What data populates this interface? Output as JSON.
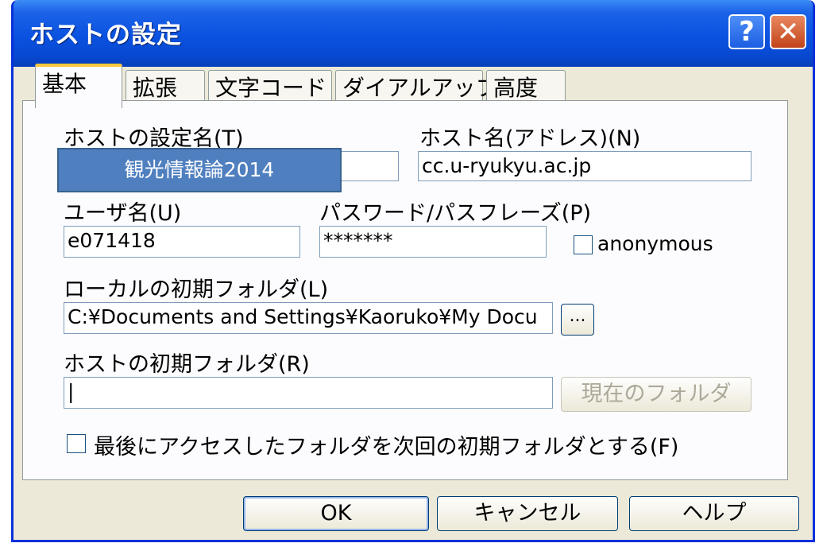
{
  "window": {
    "title": "ホストの設定",
    "help_glyph": "?",
    "close_glyph": "✕"
  },
  "tabs": [
    {
      "label": "基本",
      "active": true
    },
    {
      "label": "拡張",
      "active": false
    },
    {
      "label": "文字コード",
      "active": false
    },
    {
      "label": "ダイアルアップ",
      "active": false
    },
    {
      "label": "高度",
      "active": false
    }
  ],
  "fields": {
    "setting_name": {
      "label": "ホストの設定名(T)",
      "value": ""
    },
    "host_name": {
      "label": "ホスト名(アドレス)(N)",
      "value": "cc.u-ryukyu.ac.jp"
    },
    "username": {
      "label": "ユーザ名(U)",
      "value": "e071418"
    },
    "password": {
      "label": "パスワード/パスフレーズ(P)",
      "value": "*******"
    },
    "anonymous": {
      "label": "anonymous",
      "checked": false
    },
    "local_folder": {
      "label": "ローカルの初期フォルダ(L)",
      "value": "C:¥Documents and Settings¥Kaoruko¥My Docu",
      "browse_label": "..."
    },
    "host_folder": {
      "label": "ホストの初期フォルダ(R)",
      "value": "|",
      "current_folder_button": "現在のフォルダ"
    },
    "last_folder_checkbox": {
      "label": "最後にアクセスしたフォルダを次回の初期フォルダとする(F)",
      "checked": false
    }
  },
  "overlay_label": "観光情報論2014",
  "buttons": {
    "ok": "OK",
    "cancel": "キャンセル",
    "help": "ヘルプ"
  },
  "colors": {
    "titlebar": "#0a52e0",
    "overlay": "#4f7fbf",
    "tab_highlight": "#ffc83c"
  }
}
